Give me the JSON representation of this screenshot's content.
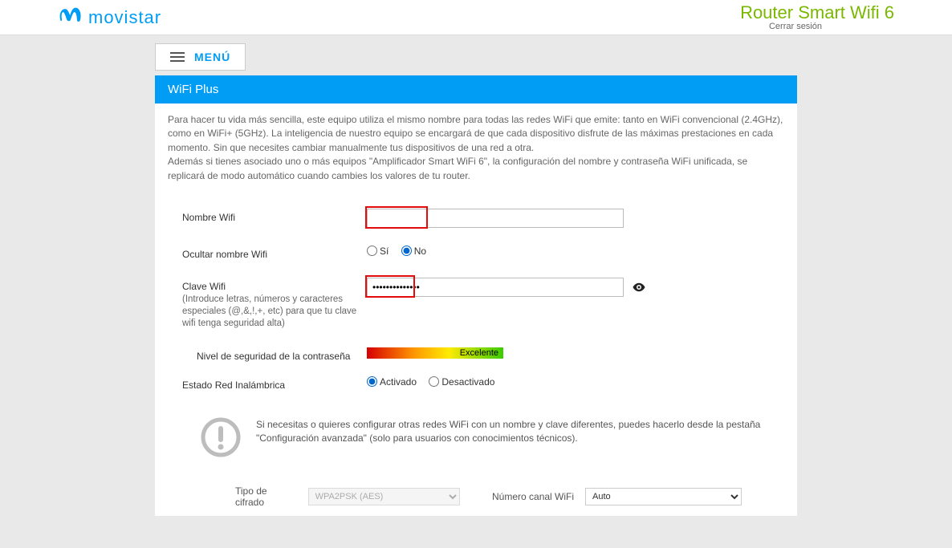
{
  "header": {
    "brand": "movistar",
    "product": "Router Smart Wifi 6",
    "logout": "Cerrar sesión"
  },
  "menu": {
    "label": "MENÚ"
  },
  "section": {
    "title": "WiFi Plus"
  },
  "intro": {
    "p1": "Para hacer tu vida más sencilla, este equipo utiliza el mismo nombre para todas las redes WiFi que emite: tanto en WiFi convencional (2.4GHz), como en WiFi+ (5GHz). La inteligencia de nuestro equipo se encargará de que cada dispositivo disfrute de las máximas prestaciones en cada momento. Sin que necesites cambiar manualmente tus dispositivos de una red a otra.",
    "p2": "Además si tienes asociado uno o más equipos \"Amplificador Smart WiFi 6\", la configuración del nombre y contraseña WiFi unificada, se replicará de modo automático cuando cambies los valores de tu router."
  },
  "form": {
    "wifi_name_label": "Nombre Wifi",
    "wifi_name_value": "",
    "hide_name_label": "Ocultar nombre Wifi",
    "yes": "Sí",
    "no": "No",
    "hide_name_selected": "no",
    "password_label": "Clave Wifi",
    "password_hint": "(Introduce letras, números y caracteres especiales (@,&,!,+, etc) para que tu clave wifi tenga seguridad alta)",
    "password_value": "••••••••••••••",
    "strength_label": "Nivel de seguridad de la contraseña",
    "strength_value": "Excelente",
    "wireless_state_label": "Estado Red Inalámbrica",
    "activated": "Activado",
    "deactivated": "Desactivado",
    "wireless_state_selected": "activated"
  },
  "notice": {
    "text": "Si necesitas o quieres configurar otras redes WiFi con un nombre y clave diferentes, puedes hacerlo desde la pestaña \"Configuración avanzada\" (solo para usuarios con conocimientos técnicos)."
  },
  "bottom": {
    "cipher_label": "Tipo de cifrado",
    "cipher_value": "WPA2PSK (AES)",
    "channel_label": "Número canal WiFi",
    "channel_value": "Auto"
  }
}
